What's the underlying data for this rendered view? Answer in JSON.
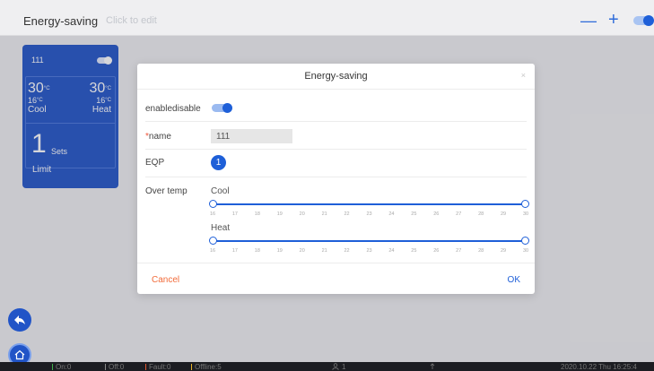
{
  "header": {
    "title": "Energy-saving",
    "edit_hint": "Click to edit",
    "minus_label": "—",
    "plus_label": "+"
  },
  "card": {
    "name": "111",
    "cool_temp": "30",
    "cool_unit": "°C",
    "cool_low": "16",
    "cool_low_unit": "°C",
    "cool_label": "Cool",
    "heat_temp": "30",
    "heat_unit": "°C",
    "heat_low": "16",
    "heat_low_unit": "°C",
    "heat_label": "Heat",
    "sets_count": "1",
    "sets_label": "Sets",
    "limit_label": "Limit"
  },
  "modal": {
    "title": "Energy-saving",
    "close": "×",
    "enable_label": "enabledisable",
    "required_mark": "*",
    "name_label": "name",
    "name_value": "111",
    "eqp_label": "EQP",
    "eqp_count": "1",
    "over_temp_label": "Over temp",
    "cool_label": "Cool",
    "heat_label": "Heat",
    "ticks": [
      "16",
      "17",
      "18",
      "19",
      "20",
      "21",
      "22",
      "23",
      "24",
      "25",
      "26",
      "27",
      "28",
      "29",
      "30"
    ],
    "cancel_label": "Cancel",
    "ok_label": "OK"
  },
  "colors": {
    "accent": "#1e5fd8",
    "card": "#2154c7",
    "cancel": "#f26b3a"
  },
  "status": {
    "on": "On:0",
    "off": "Off:0",
    "fault": "Fault:0",
    "offline": "Offline:5",
    "users": "1",
    "date": "2020.10.22   Thu   16:25:4"
  }
}
